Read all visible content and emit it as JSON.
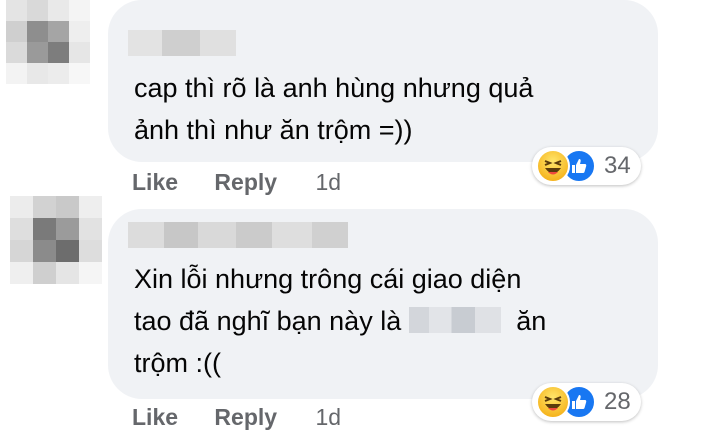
{
  "comments": [
    {
      "text_lines": [
        "cap thì rõ là anh hùng nhưng quả",
        "ảnh thì như ăn trộm =))"
      ],
      "reaction_icons": [
        "haha-icon",
        "like-icon"
      ],
      "reaction_count": "34",
      "actions": {
        "like": "Like",
        "reply": "Reply",
        "time": "1d"
      }
    },
    {
      "text_line1": "Xin lỗi nhưng trông cái giao diện",
      "text_line2_before": "tao đã nghĩ bạn này là",
      "text_line2_after": "ăn",
      "text_line3": "trộm :((",
      "reaction_icons": [
        "haha-icon",
        "like-icon"
      ],
      "reaction_count": "28",
      "actions": {
        "like": "Like",
        "reply": "Reply",
        "time": "1d"
      }
    }
  ],
  "colors": {
    "bubble": "#f0f2f5",
    "text": "#050505",
    "secondary": "#65676b",
    "like_blue": "#1877f2",
    "haha_yellow": "#f7c12d"
  }
}
